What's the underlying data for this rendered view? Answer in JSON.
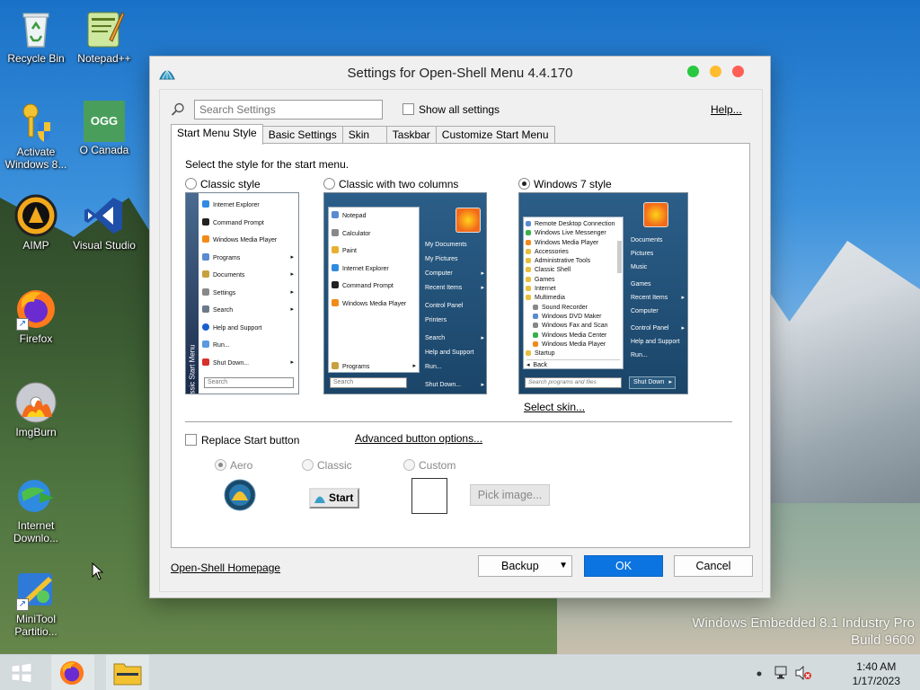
{
  "desktop": {
    "icons": [
      {
        "label": "Recycle Bin",
        "icon": "recycle-bin-icon"
      },
      {
        "label": "Notepad++",
        "icon": "notepad-plus-plus-icon"
      },
      {
        "label": "Activate Windows 8...",
        "icon": "key-shield-icon"
      },
      {
        "label": "O Canada",
        "icon": "ogg-file-icon",
        "badge": "OGG"
      },
      {
        "label": "AIMP",
        "icon": "aimp-icon"
      },
      {
        "label": "Visual Studio",
        "icon": "visual-studio-icon"
      },
      {
        "label": "Firefox",
        "icon": "firefox-icon"
      },
      {
        "label": "ImgBurn",
        "icon": "imgburn-icon"
      },
      {
        "label": "Internet Downlo...",
        "icon": "internet-download-manager-icon"
      },
      {
        "label": "MiniTool Partitio...",
        "icon": "minitool-partition-icon"
      }
    ],
    "watermark_line1": "Windows Embedded 8.1 Industry Pro",
    "watermark_line2": "Build 9600"
  },
  "window": {
    "title": "Settings for Open-Shell Menu 4.4.170",
    "search_placeholder": "Search Settings",
    "show_all_label": "Show all settings",
    "help_label": "Help...",
    "tabs": [
      "Start Menu Style",
      "Basic Settings",
      "Skin",
      "Taskbar",
      "Customize Start Menu"
    ],
    "active_tab": 0,
    "style_prompt": "Select the style for the start menu.",
    "styles": [
      {
        "label": "Classic style",
        "selected": false
      },
      {
        "label": "Classic with two columns",
        "selected": false
      },
      {
        "label": "Windows 7 style",
        "selected": true
      }
    ],
    "preview_classic": {
      "items": [
        "Internet Explorer",
        "Command Prompt",
        "Windows Media Player",
        "Programs",
        "Documents",
        "Settings",
        "Search",
        "Help and Support",
        "Run...",
        "Shut Down..."
      ],
      "side_label": "Classic Start Menu",
      "search": "Search"
    },
    "preview_twocol": {
      "left_items": [
        "Notepad",
        "Calculator",
        "Paint",
        "Internet Explorer",
        "Command Prompt",
        "Windows Media Player"
      ],
      "programs": "Programs",
      "search": "Search",
      "right_items": [
        "My Documents",
        "My Pictures",
        "Computer",
        "Recent Items",
        "Control Panel",
        "Printers",
        "Search",
        "Help and Support",
        "Run...",
        "Shut Down..."
      ]
    },
    "preview_win7": {
      "left_items": [
        "Remote Desktop Connection",
        "Windows Live Messenger",
        "Windows Media Player",
        "Accessories",
        "Administrative Tools",
        "Classic Shell",
        "Games",
        "Internet",
        "Multimedia",
        "Sound Recorder",
        "Windows DVD Maker",
        "Windows Fax and Scan",
        "Windows Media Center",
        "Windows Media Player",
        "Startup"
      ],
      "back": "Back",
      "search": "Search programs and files",
      "right_items": [
        "Documents",
        "Pictures",
        "Music",
        "Games",
        "Recent Items",
        "Computer",
        "Control Panel",
        "Help and Support",
        "Run..."
      ],
      "shutdown": "Shut Down"
    },
    "select_skin_label": "Select skin...",
    "replace_start_label": "Replace Start button",
    "advanced_button_label": "Advanced button options...",
    "button_styles": [
      {
        "label": "Aero",
        "selected": true
      },
      {
        "label": "Classic",
        "selected": false
      },
      {
        "label": "Custom",
        "selected": false
      }
    ],
    "classic_start_label": "Start",
    "pick_image_label": "Pick image...",
    "homepage_label": "Open-Shell Homepage",
    "backup_label": "Backup",
    "ok_label": "OK",
    "cancel_label": "Cancel"
  },
  "taskbar": {
    "time": "1:40 AM",
    "date": "1/17/2023"
  }
}
